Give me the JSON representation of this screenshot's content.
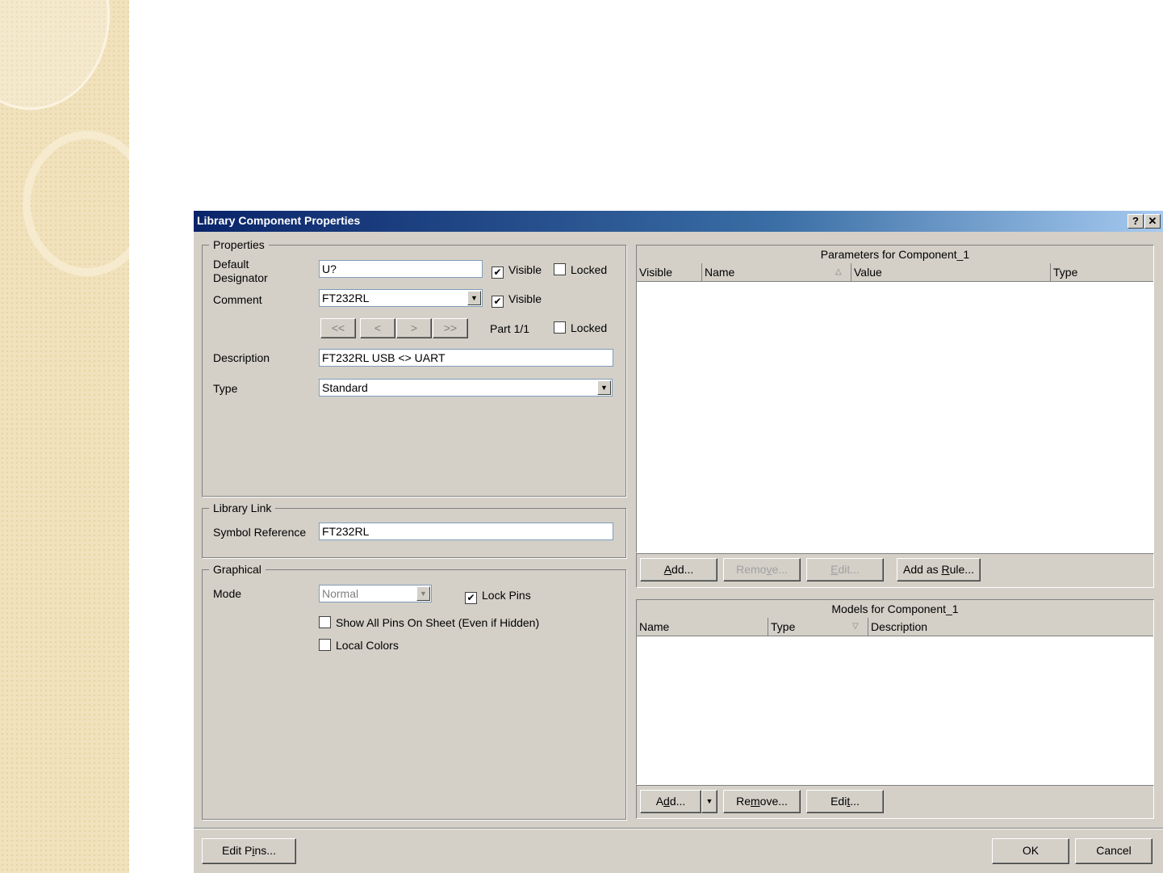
{
  "dialog": {
    "title": "Library Component Properties",
    "help_label": "?",
    "close_label": "✕"
  },
  "properties": {
    "legend": "Properties",
    "default_designator_label_1": "Default",
    "default_designator_label_2": "Designator",
    "default_designator_value": "U?",
    "designator_visible_label": "Visible",
    "designator_visible_checked": true,
    "designator_locked_label": "Locked",
    "designator_locked_checked": false,
    "comment_label": "Comment",
    "comment_value": "FT232RL",
    "comment_visible_label": "Visible",
    "comment_visible_checked": true,
    "nav_first": "<<",
    "nav_prev": "<",
    "nav_next": ">",
    "nav_last": ">>",
    "part_label": "Part 1/1",
    "part_locked_label": "Locked",
    "part_locked_checked": false,
    "description_label": "Description",
    "description_value": "FT232RL USB <> UART",
    "type_label": "Type",
    "type_value": "Standard"
  },
  "library_link": {
    "legend": "Library Link",
    "symbol_reference_label": "Symbol Reference",
    "symbol_reference_value": "FT232RL"
  },
  "graphical": {
    "legend": "Graphical",
    "mode_label": "Mode",
    "mode_value": "Normal",
    "lock_pins_label": "Lock Pins",
    "lock_pins_checked": true,
    "show_all_pins_label": "Show All Pins On Sheet (Even if Hidden)",
    "show_all_pins_checked": false,
    "local_colors_label": "Local Colors",
    "local_colors_checked": false
  },
  "parameters": {
    "caption": "Parameters for Component_1",
    "columns": [
      "Visible",
      "Name",
      "Value",
      "Type"
    ],
    "rows": [],
    "add_label": "Add...",
    "remove_label": "Remove...",
    "edit_label": "Edit...",
    "add_as_rule_label": "Add as Rule..."
  },
  "models": {
    "caption": "Models for Component_1",
    "columns": [
      "Name",
      "Type",
      "Description"
    ],
    "rows": [],
    "add_label": "Add...",
    "remove_label": "Remove...",
    "edit_label": "Edit..."
  },
  "footer": {
    "edit_pins_label": "Edit Pins...",
    "ok_label": "OK",
    "cancel_label": "Cancel"
  },
  "icons": {
    "check": "✔",
    "dropdown": "▼",
    "sort_asc": "△",
    "sort_desc": "▽"
  }
}
